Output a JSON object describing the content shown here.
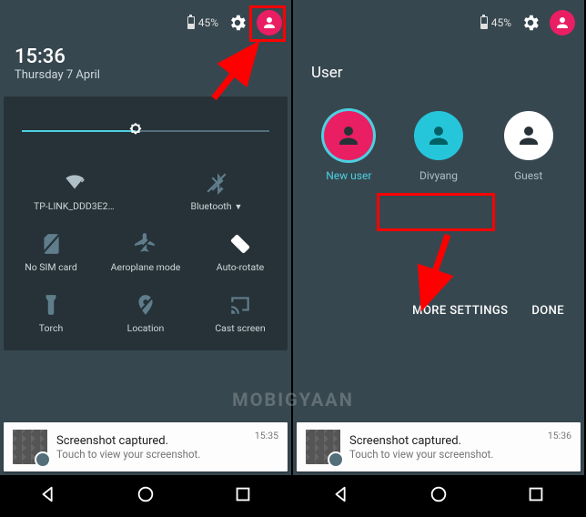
{
  "left": {
    "battery_pct": "45%",
    "time": "15:36",
    "date": "Thursday 7 April",
    "brightness_pct": 46,
    "tiles": {
      "wifi": "TP-LINK_DDD3E2",
      "bluetooth": "Bluetooth",
      "sim": "No SIM card",
      "airplane": "Aeroplane mode",
      "autorotate": "Auto-rotate",
      "torch": "Torch",
      "location": "Location",
      "cast": "Cast screen"
    },
    "notification": {
      "title": "Screenshot captured.",
      "subtitle": "Touch to view your screenshot.",
      "time": "15:35"
    }
  },
  "right": {
    "battery_pct": "45%",
    "panel_title": "User",
    "users": [
      {
        "name": "New user"
      },
      {
        "name": "Divyang"
      },
      {
        "name": "Guest"
      }
    ],
    "more_settings": "MORE SETTINGS",
    "done": "DONE",
    "notification": {
      "title": "Screenshot captured.",
      "subtitle": "Touch to view your screenshot.",
      "time": "15:36"
    }
  },
  "watermark": "MOBIGYAAN"
}
